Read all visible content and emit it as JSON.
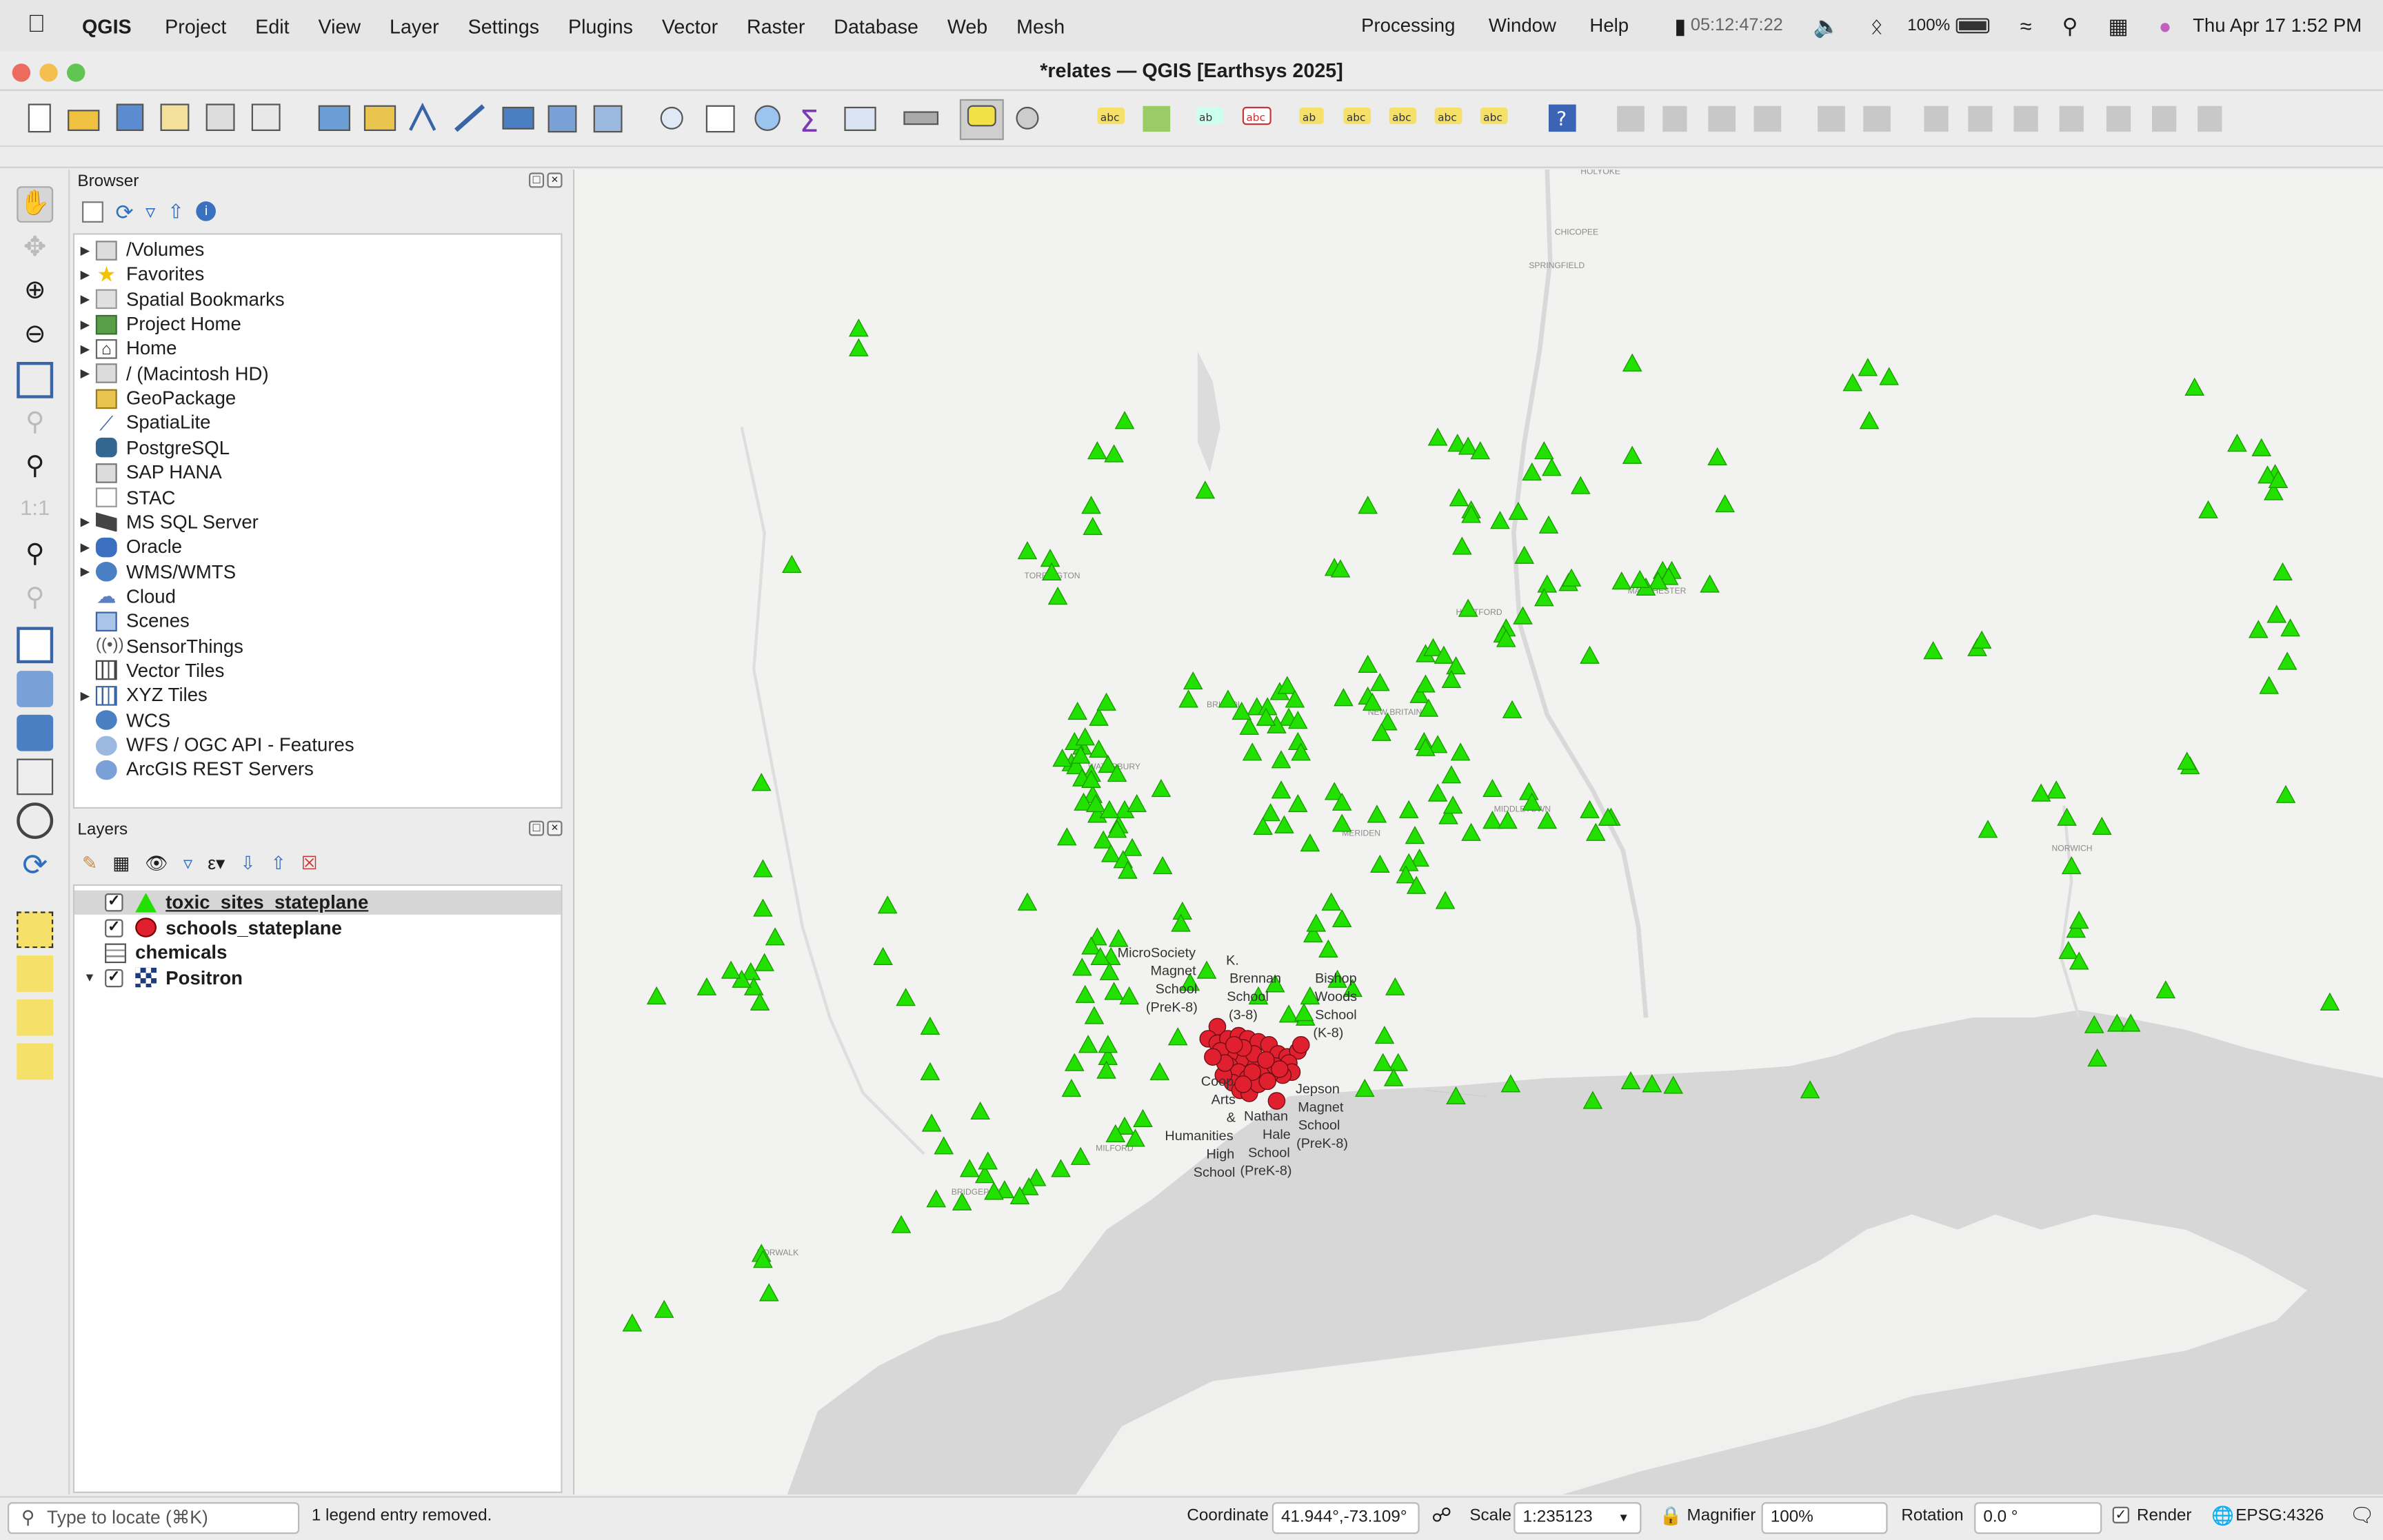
{
  "menubar": {
    "app": "QGIS",
    "items": [
      "Project",
      "Edit",
      "View",
      "Layer",
      "Settings",
      "Plugins",
      "Vector",
      "Raster",
      "Database",
      "Web",
      "Mesh"
    ],
    "right_items": [
      "Processing",
      "Window",
      "Help"
    ],
    "clock_widget": "05:12:47:22",
    "battery": "100%",
    "datetime": "Thu Apr 17  1:52 PM"
  },
  "window": {
    "title": "*relates — QGIS [Earthsys 2025]"
  },
  "browser": {
    "title": "Browser",
    "items": [
      {
        "label": "/Volumes",
        "icon": "folder-icon",
        "expandable": true
      },
      {
        "label": "Favorites",
        "icon": "star-icon",
        "expandable": true
      },
      {
        "label": "Spatial Bookmarks",
        "icon": "bookmark-icon",
        "expandable": true
      },
      {
        "label": "Project Home",
        "icon": "project-home-icon",
        "expandable": true
      },
      {
        "label": "Home",
        "icon": "home-icon",
        "expandable": true
      },
      {
        "label": "/ (Macintosh HD)",
        "icon": "folder-icon",
        "expandable": true
      },
      {
        "label": "GeoPackage",
        "icon": "geopackage-icon",
        "expandable": false
      },
      {
        "label": "SpatiaLite",
        "icon": "spatialite-icon",
        "expandable": false
      },
      {
        "label": "PostgreSQL",
        "icon": "postgresql-icon",
        "expandable": false
      },
      {
        "label": "SAP HANA",
        "icon": "sap-hana-icon",
        "expandable": false
      },
      {
        "label": "STAC",
        "icon": "stac-icon",
        "expandable": false
      },
      {
        "label": "MS SQL Server",
        "icon": "mssql-icon",
        "expandable": true
      },
      {
        "label": "Oracle",
        "icon": "oracle-icon",
        "expandable": true
      },
      {
        "label": "WMS/WMTS",
        "icon": "wms-icon",
        "expandable": true
      },
      {
        "label": "Cloud",
        "icon": "cloud-icon",
        "expandable": false
      },
      {
        "label": "Scenes",
        "icon": "scenes-icon",
        "expandable": false
      },
      {
        "label": "SensorThings",
        "icon": "sensorthings-icon",
        "expandable": false
      },
      {
        "label": "Vector Tiles",
        "icon": "vector-tiles-icon",
        "expandable": false
      },
      {
        "label": "XYZ Tiles",
        "icon": "xyz-tiles-icon",
        "expandable": true
      },
      {
        "label": "WCS",
        "icon": "wcs-icon",
        "expandable": false
      },
      {
        "label": "WFS / OGC API - Features",
        "icon": "wfs-icon",
        "expandable": false
      },
      {
        "label": "ArcGIS REST Servers",
        "icon": "arcgis-icon",
        "expandable": false
      }
    ]
  },
  "layers": {
    "title": "Layers",
    "items": [
      {
        "label": "toxic_sites_stateplane",
        "checked": true,
        "symbol": "green-triangle",
        "selected": true
      },
      {
        "label": "schools_stateplane",
        "checked": true,
        "symbol": "red-circle",
        "selected": false
      },
      {
        "label": "chemicals",
        "checked": null,
        "symbol": "table-icon",
        "selected": false
      },
      {
        "label": "Positron",
        "checked": true,
        "symbol": "xyz-tile-icon",
        "selected": false,
        "expandable": true
      }
    ]
  },
  "map": {
    "colors": {
      "toxic": "#22e000",
      "school": "#e0202e",
      "water": "#d6d6d6",
      "land": "#f2f2f0"
    },
    "place_labels": [
      "HOLYOKE",
      "CHICOPEE",
      "SPRINGFIELD",
      "TORRINGTON",
      "HARTFORD",
      "BRISTOL",
      "NEW BRITAIN",
      "MIDDLETOWN",
      "NORWICH",
      "MERIDEN",
      "WATERBURY",
      "BRIDGEPORT",
      "MILFORD",
      "NORWALK",
      "MANCHESTER"
    ],
    "school_labels": [
      {
        "text": "MicroSociety Magnet School (PreK-8)"
      },
      {
        "text": "K. Brennan School (3-8)"
      },
      {
        "text": "Bishop Woods School (K-8)"
      },
      {
        "text": "Jepson Magnet School (PreK-8)"
      },
      {
        "text": "Nathan Hale School (PreK-8)"
      },
      {
        "text": "Arts & Humanities High School"
      },
      {
        "text": "Coop"
      }
    ]
  },
  "statusbar": {
    "locate_placeholder": "Type to locate (⌘K)",
    "message": "1 legend entry removed.",
    "coordinate_label": "Coordinate",
    "coordinate": "41.944°,-73.109°",
    "scale_label": "Scale",
    "scale": "1:235123",
    "magnifier_label": "Magnifier",
    "magnifier": "100%",
    "rotation_label": "Rotation",
    "rotation": "0.0 °",
    "render_label": "Render",
    "crs": "EPSG:4326"
  }
}
